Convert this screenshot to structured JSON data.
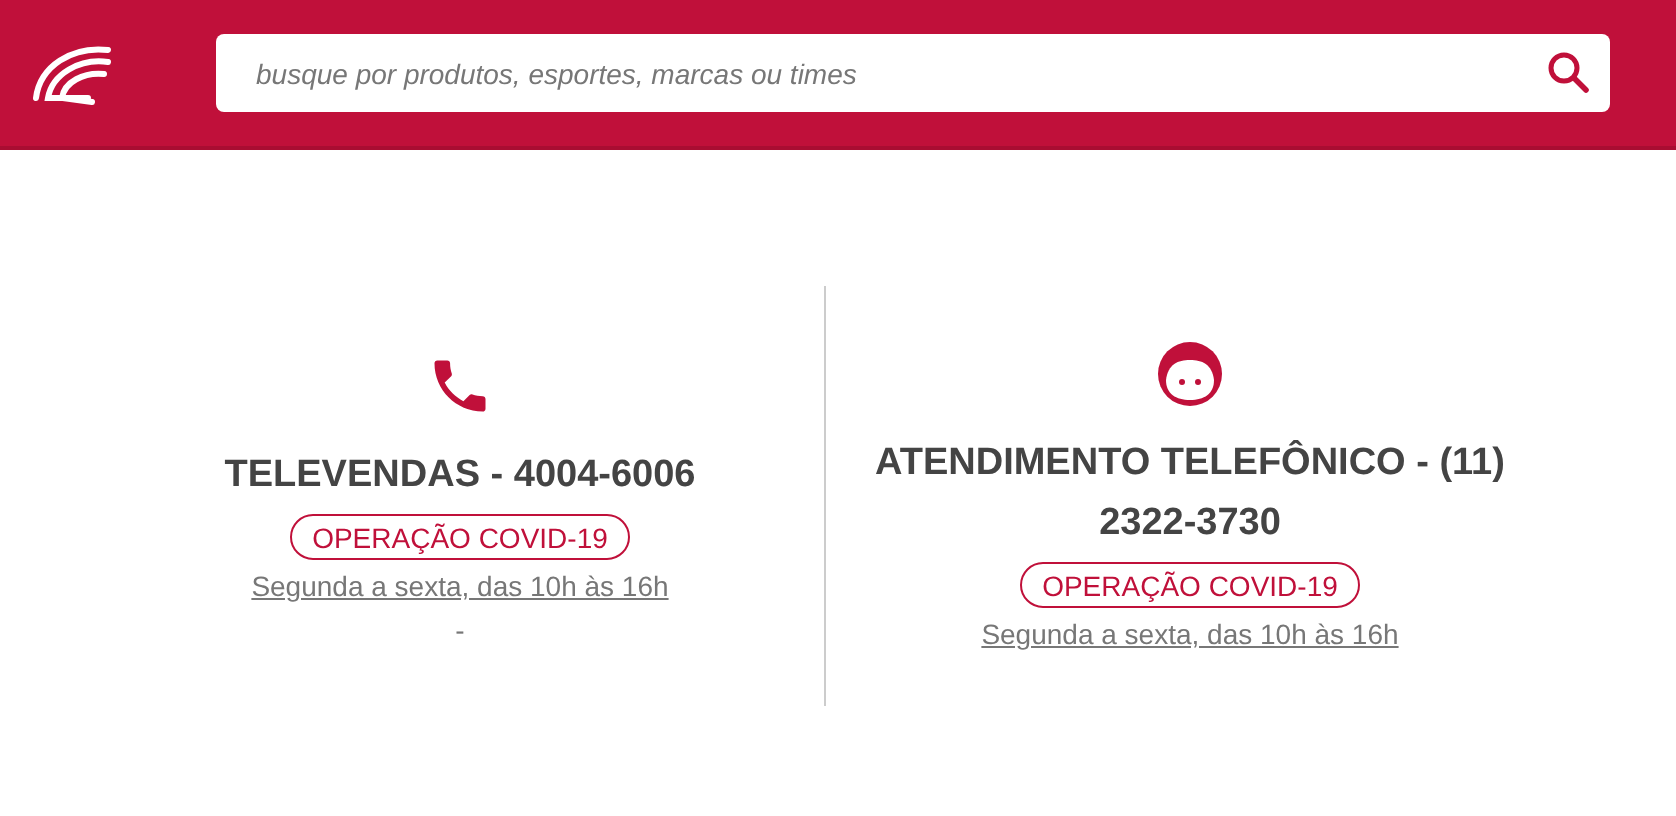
{
  "header": {
    "search": {
      "placeholder": "busque por produtos, esportes, marcas ou times"
    }
  },
  "contacts": [
    {
      "kind": "phone",
      "title": "TELEVENDAS - 4004-6006",
      "badge": "OPERAÇÃO COVID-19",
      "hours": "Segunda a sexta, das 10h às 16h",
      "note": "-"
    },
    {
      "kind": "face",
      "title": "ATENDIMENTO TELEFÔNICO - (11) 2322-3730",
      "badge": "OPERAÇÃO COVID-19",
      "hours": "Segunda a sexta, das 10h às 16h"
    }
  ]
}
